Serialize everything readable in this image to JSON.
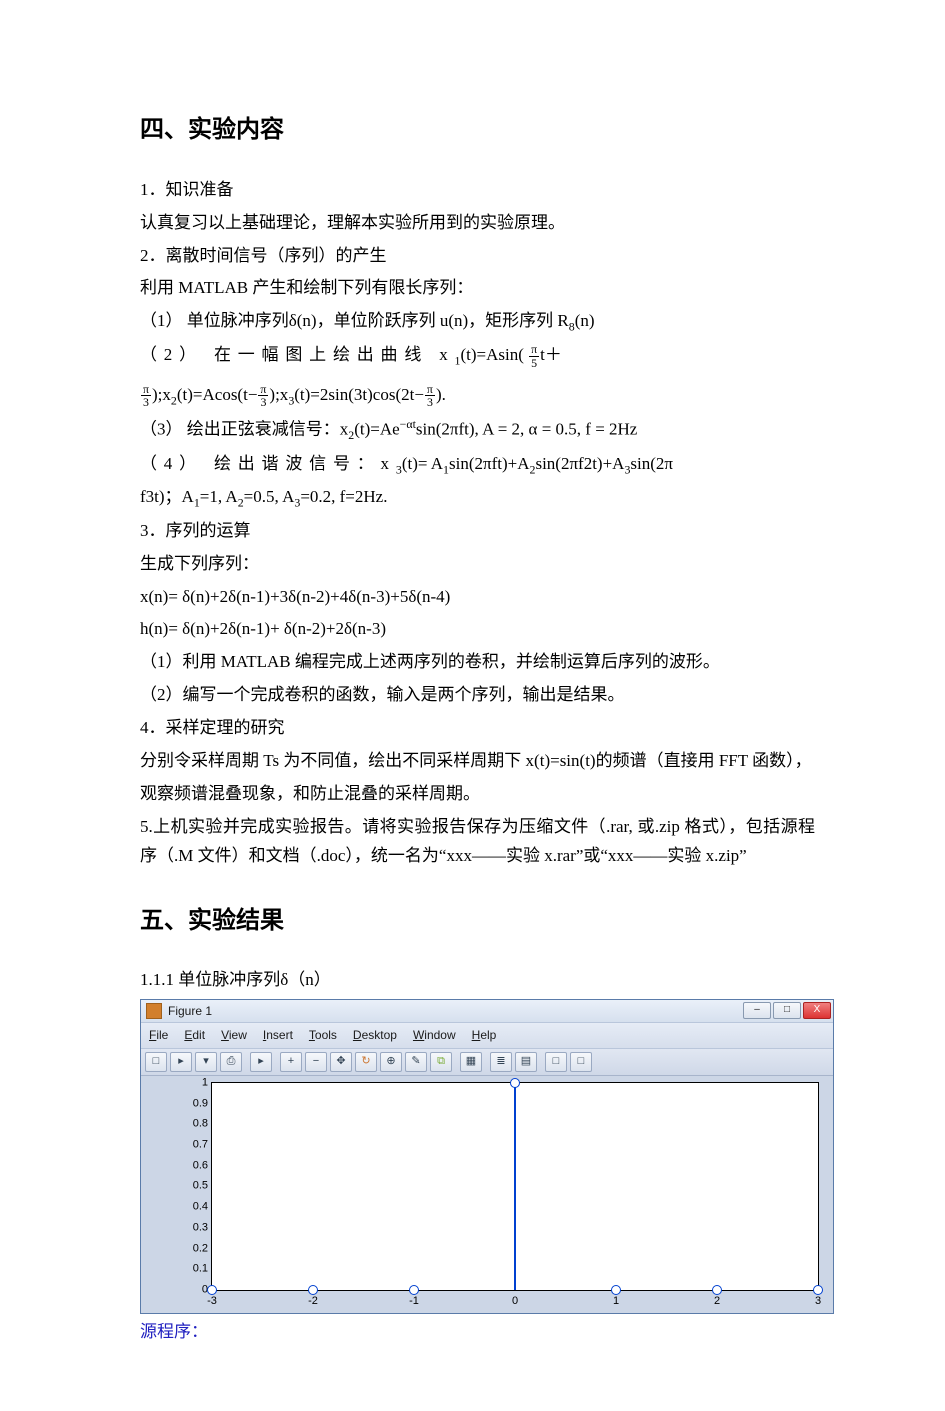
{
  "section4": {
    "heading": "四、实验内容",
    "p1": "1．知识准备",
    "p2": "认真复习以上基础理论，理解本实验所用到的实验原理。",
    "p3": "2．离散时间信号（序列）的产生",
    "p4": "利用 MATLAB 产生和绘制下列有限长序列：",
    "s1_pre": "（1） 单位脉冲序列δ(n)，单位阶跃序列 u(n)，矩形序列 R",
    "s1_sub": "8",
    "s1_post": "(n)",
    "s2_pre": "（2） 在一幅图上绘出曲线 x",
    "s2_eq1a": "(t)=Asin(",
    "s2_eq1b_num": "π",
    "s2_eq1b_den": "5",
    "s2_eq1c": "t＋",
    "s2_eq2_num": "π",
    "s2_eq2_den": "3",
    "s2_eq2a": ");x",
    "s2_eq2b": "(t)=Acos(t−",
    "s2_eq2c_num": "π",
    "s2_eq2c_den": "3",
    "s2_eq2d": ");x",
    "s2_eq3a": "(t)=2sin(3t)cos(2t−",
    "s2_eq3b_num": "π",
    "s2_eq3b_den": "3",
    "s2_eq3c": ").",
    "s3_pre": "（3） 绘出正弦衰减信号：x",
    "s3_sub2": "2",
    "s3_body": "(t)=Ae",
    "s3_exp": "−αt",
    "s3_post": "sin(2πft), A = 2, α = 0.5, f = 2Hz",
    "s4_pre": "（4） 绘出谐波信号：x",
    "s4_sub3": "3",
    "s4_body1": "(t)= A",
    "s4_subA1": "1",
    "s4_body2": "sin(2πft)+A",
    "s4_subA2": "2",
    "s4_body3": "sin(2πf2t)+A",
    "s4_subA3": "3",
    "s4_body4": "sin(2πf3t)；A",
    "s4_p2a": "=1, A",
    "s4_p2b": "=0.5, A",
    "s4_p2c": "=0.2, f=2Hz.",
    "p5": "3．序列的运算",
    "p6": "生成下列序列：",
    "p7": "x(n)= δ(n)+2δ(n-1)+3δ(n-2)+4δ(n-3)+5δ(n-4)",
    "p8": "h(n)=  δ(n)+2δ(n-1)+ δ(n-2)+2δ(n-3)",
    "s5": "（1）利用 MATLAB 编程完成上述两序列的卷积，并绘制运算后序列的波形。",
    "s6": "（2）编写一个完成卷积的函数，输入是两个序列，输出是结果。",
    "p9": "4．采样定理的研究",
    "p10": "分别令采样周期 Ts 为不同值，绘出不同采样周期下 x(t)=sin(t)的频谱（直接用 FFT 函数），",
    "p11": "观察频谱混叠现象，和防止混叠的采样周期。",
    "p12": "5.上机实验并完成实验报告。请将实验报告保存为压缩文件（.rar, 或.zip 格式），包括源程序（.M 文件）和文档（.doc），统一名为“xxx——实验 x.rar”或“xxx——实验 x.zip”"
  },
  "section5": {
    "heading": "五、实验结果",
    "p1": "1.1.1 单位脉冲序列δ（n）",
    "source": "源程序："
  },
  "figure": {
    "title": "Figure 1",
    "menu": {
      "file": "File",
      "edit": "Edit",
      "view": "View",
      "insert": "Insert",
      "tools": "Tools",
      "desktop": "Desktop",
      "window": "Window",
      "help": "Help"
    },
    "winbtn": {
      "min": "–",
      "max": "□",
      "close": "X"
    },
    "toolbar": {
      "new": "□",
      "open": "▸",
      "save": "▾",
      "print": "⎙",
      "arrow": "▸",
      "zoomin": "+",
      "zoomout": "−",
      "pan": "✥",
      "rotate": "↻",
      "cursor": "⊕",
      "brush": "✎",
      "link": "⧉",
      "cmap": "▦",
      "legend": "≣",
      "grid": "▤",
      "sep": "|",
      "box1": "□",
      "box2": "□"
    }
  },
  "chart_data": {
    "type": "bar",
    "title": "",
    "xlabel": "",
    "ylabel": "",
    "xlim": [
      -3,
      3
    ],
    "ylim": [
      0,
      1
    ],
    "xticks": [
      -3,
      -2,
      -1,
      0,
      1,
      2,
      3
    ],
    "yticks": [
      0,
      0.1,
      0.2,
      0.3,
      0.4,
      0.5,
      0.6,
      0.7,
      0.8,
      0.9,
      1
    ],
    "n": [
      -3,
      -2,
      -1,
      0,
      1,
      2,
      3
    ],
    "values": [
      0,
      0,
      0,
      1,
      0,
      0,
      0
    ]
  }
}
